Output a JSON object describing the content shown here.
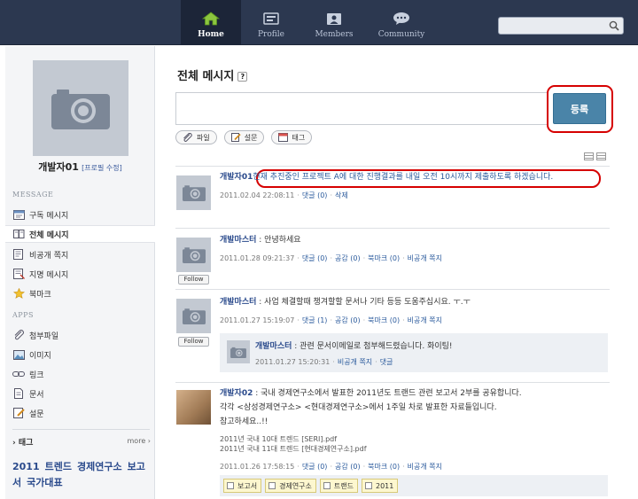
{
  "nav": {
    "items": [
      {
        "label": "Home",
        "icon": "home-icon",
        "active": true
      },
      {
        "label": "Profile",
        "icon": "profile-icon",
        "active": false
      },
      {
        "label": "Members",
        "icon": "members-icon",
        "active": false
      },
      {
        "label": "Community",
        "icon": "community-icon",
        "active": false
      }
    ],
    "search_placeholder": ""
  },
  "sidebar": {
    "user_name": "개발자01",
    "edit_profile": "[프로필 수정]",
    "message_label": "MESSAGE",
    "message_items": [
      {
        "label": "구독 메시지",
        "icon": "subscribe-icon"
      },
      {
        "label": "전체 메시지",
        "icon": "all-messages-icon",
        "active": true
      },
      {
        "label": "비공개 쪽지",
        "icon": "private-note-icon"
      },
      {
        "label": "지명 메시지",
        "icon": "mention-icon"
      },
      {
        "label": "북마크",
        "icon": "bookmark-star-icon"
      }
    ],
    "apps_label": "APPS",
    "app_items": [
      {
        "label": "첨부파일",
        "icon": "paperclip-icon"
      },
      {
        "label": "이미지",
        "icon": "image-icon"
      },
      {
        "label": "링크",
        "icon": "link-icon"
      },
      {
        "label": "문서",
        "icon": "document-icon"
      },
      {
        "label": "설문",
        "icon": "survey-icon"
      }
    ],
    "tags_label": "태그",
    "more_label": "more",
    "tag_cloud": [
      "2011",
      "트렌드",
      "경제연구소",
      "보고서",
      "국가대표"
    ]
  },
  "main": {
    "title": "전체 메시지",
    "help": "?",
    "submit_label": "등록",
    "attach_buttons": [
      {
        "label": "파일",
        "icon": "paperclip-icon"
      },
      {
        "label": "설문",
        "icon": "survey-icon"
      },
      {
        "label": "태그",
        "icon": "tag-icon"
      }
    ]
  },
  "posts": [
    {
      "author": "개발자01",
      "text": "현재 추진중인 프로젝트 A에 대한 진행결과를 내일 오전 10시까지 제출하도록 하겠습니다.",
      "time": "2011.02.04 22:08:11",
      "actions": [
        "댓글 (0)",
        "삭제"
      ]
    },
    {
      "author": "개발마스터",
      "text": " : 안녕하세요",
      "time": "2011.01.28 09:21:37",
      "actions": [
        "댓글 (0)",
        "공감 (0)",
        "북마크 (0)",
        "비공개 쪽지"
      ],
      "follow": "Follow"
    },
    {
      "author": "개발마스터",
      "text": " : 사업 체결할때 챙겨할할 문서나 기타 등등 도움주십시요. ㅜ.ㅜ",
      "time": "2011.01.27 15:19:07",
      "actions": [
        "댓글 (1)",
        "공감 (0)",
        "북마크 (0)",
        "비공개 쪽지"
      ],
      "follow": "Follow",
      "reply": {
        "author": "개발마스터",
        "text": " : 관련 문서이메일로 첨부해드렸습니다. 화이팅!",
        "time": "2011.01.27 15:20:31",
        "actions": [
          "비공개 쪽지",
          "댓글"
        ]
      }
    },
    {
      "author": "개발자02",
      "text": " : 국내 경제연구소에서 발표한 2011년도 트랜드 관련 보고서 2부를 공유합니다.",
      "text2": "각각 <삼성경제연구소> <현대경제연구소>에서 1주일 차로 발표한 자료들입니다.",
      "text3": "참고하세요..!!",
      "files": [
        "2011년 국내 10대 트렌드 [SERI].pdf",
        "2011년 국내 11대 트렌드 [현대경제연구소].pdf"
      ],
      "time": "2011.01.26 17:58:15",
      "actions": [
        "댓글 (0)",
        "공감 (0)",
        "북마크 (0)",
        "비공개 쪽지"
      ],
      "tags": [
        "보고서",
        "경제연구소",
        "트랜드",
        "2011"
      ]
    }
  ],
  "colors": {
    "topbar": "#2c3850",
    "accent_button": "#4a84a8",
    "highlight_ring": "#d60000",
    "link": "#2a4a8c"
  }
}
